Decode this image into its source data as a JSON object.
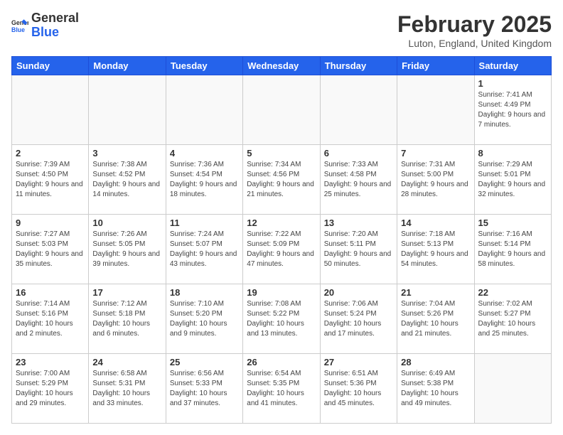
{
  "header": {
    "logo_general": "General",
    "logo_blue": "Blue",
    "month": "February 2025",
    "location": "Luton, England, United Kingdom"
  },
  "weekdays": [
    "Sunday",
    "Monday",
    "Tuesday",
    "Wednesday",
    "Thursday",
    "Friday",
    "Saturday"
  ],
  "weeks": [
    [
      {
        "day": "",
        "info": ""
      },
      {
        "day": "",
        "info": ""
      },
      {
        "day": "",
        "info": ""
      },
      {
        "day": "",
        "info": ""
      },
      {
        "day": "",
        "info": ""
      },
      {
        "day": "",
        "info": ""
      },
      {
        "day": "1",
        "info": "Sunrise: 7:41 AM\nSunset: 4:49 PM\nDaylight: 9 hours and 7 minutes."
      }
    ],
    [
      {
        "day": "2",
        "info": "Sunrise: 7:39 AM\nSunset: 4:50 PM\nDaylight: 9 hours and 11 minutes."
      },
      {
        "day": "3",
        "info": "Sunrise: 7:38 AM\nSunset: 4:52 PM\nDaylight: 9 hours and 14 minutes."
      },
      {
        "day": "4",
        "info": "Sunrise: 7:36 AM\nSunset: 4:54 PM\nDaylight: 9 hours and 18 minutes."
      },
      {
        "day": "5",
        "info": "Sunrise: 7:34 AM\nSunset: 4:56 PM\nDaylight: 9 hours and 21 minutes."
      },
      {
        "day": "6",
        "info": "Sunrise: 7:33 AM\nSunset: 4:58 PM\nDaylight: 9 hours and 25 minutes."
      },
      {
        "day": "7",
        "info": "Sunrise: 7:31 AM\nSunset: 5:00 PM\nDaylight: 9 hours and 28 minutes."
      },
      {
        "day": "8",
        "info": "Sunrise: 7:29 AM\nSunset: 5:01 PM\nDaylight: 9 hours and 32 minutes."
      }
    ],
    [
      {
        "day": "9",
        "info": "Sunrise: 7:27 AM\nSunset: 5:03 PM\nDaylight: 9 hours and 35 minutes."
      },
      {
        "day": "10",
        "info": "Sunrise: 7:26 AM\nSunset: 5:05 PM\nDaylight: 9 hours and 39 minutes."
      },
      {
        "day": "11",
        "info": "Sunrise: 7:24 AM\nSunset: 5:07 PM\nDaylight: 9 hours and 43 minutes."
      },
      {
        "day": "12",
        "info": "Sunrise: 7:22 AM\nSunset: 5:09 PM\nDaylight: 9 hours and 47 minutes."
      },
      {
        "day": "13",
        "info": "Sunrise: 7:20 AM\nSunset: 5:11 PM\nDaylight: 9 hours and 50 minutes."
      },
      {
        "day": "14",
        "info": "Sunrise: 7:18 AM\nSunset: 5:13 PM\nDaylight: 9 hours and 54 minutes."
      },
      {
        "day": "15",
        "info": "Sunrise: 7:16 AM\nSunset: 5:14 PM\nDaylight: 9 hours and 58 minutes."
      }
    ],
    [
      {
        "day": "16",
        "info": "Sunrise: 7:14 AM\nSunset: 5:16 PM\nDaylight: 10 hours and 2 minutes."
      },
      {
        "day": "17",
        "info": "Sunrise: 7:12 AM\nSunset: 5:18 PM\nDaylight: 10 hours and 6 minutes."
      },
      {
        "day": "18",
        "info": "Sunrise: 7:10 AM\nSunset: 5:20 PM\nDaylight: 10 hours and 9 minutes."
      },
      {
        "day": "19",
        "info": "Sunrise: 7:08 AM\nSunset: 5:22 PM\nDaylight: 10 hours and 13 minutes."
      },
      {
        "day": "20",
        "info": "Sunrise: 7:06 AM\nSunset: 5:24 PM\nDaylight: 10 hours and 17 minutes."
      },
      {
        "day": "21",
        "info": "Sunrise: 7:04 AM\nSunset: 5:26 PM\nDaylight: 10 hours and 21 minutes."
      },
      {
        "day": "22",
        "info": "Sunrise: 7:02 AM\nSunset: 5:27 PM\nDaylight: 10 hours and 25 minutes."
      }
    ],
    [
      {
        "day": "23",
        "info": "Sunrise: 7:00 AM\nSunset: 5:29 PM\nDaylight: 10 hours and 29 minutes."
      },
      {
        "day": "24",
        "info": "Sunrise: 6:58 AM\nSunset: 5:31 PM\nDaylight: 10 hours and 33 minutes."
      },
      {
        "day": "25",
        "info": "Sunrise: 6:56 AM\nSunset: 5:33 PM\nDaylight: 10 hours and 37 minutes."
      },
      {
        "day": "26",
        "info": "Sunrise: 6:54 AM\nSunset: 5:35 PM\nDaylight: 10 hours and 41 minutes."
      },
      {
        "day": "27",
        "info": "Sunrise: 6:51 AM\nSunset: 5:36 PM\nDaylight: 10 hours and 45 minutes."
      },
      {
        "day": "28",
        "info": "Sunrise: 6:49 AM\nSunset: 5:38 PM\nDaylight: 10 hours and 49 minutes."
      },
      {
        "day": "",
        "info": ""
      }
    ]
  ]
}
